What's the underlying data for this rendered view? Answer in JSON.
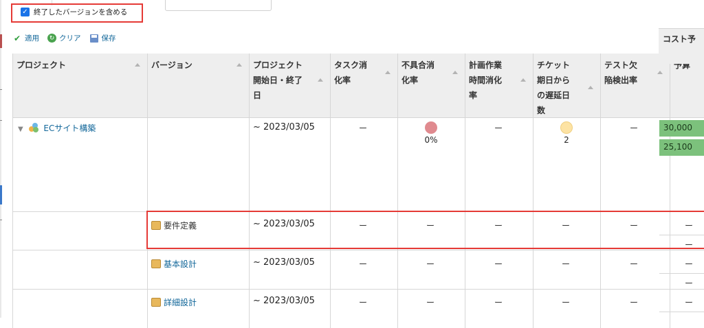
{
  "filter": {
    "include_closed_label": "終了したバージョンを含める",
    "include_closed_checked": true
  },
  "toolbar": {
    "apply": "適用",
    "clear": "クリア",
    "save": "保存"
  },
  "table": {
    "headers": {
      "project": "プロジェクト",
      "version": "バージョン",
      "dates": [
        "プロジェクト",
        "開始日・終了",
        "日"
      ],
      "task": [
        "タスク消",
        "化率"
      ],
      "defect": [
        "不具合消",
        "化率"
      ],
      "plan": [
        "計画作業",
        "時間消化",
        "率"
      ],
      "ticket": [
        "チケット",
        "期日から",
        "の遅延日",
        "数"
      ],
      "testdef": [
        "テスト欠",
        "陥検出率"
      ],
      "budget": "予算",
      "budget_sub": "コスト予"
    },
    "dash": "ー",
    "project_row": {
      "name": "ECサイト構築",
      "date": "~ 2023/03/05",
      "defect_value": "0%",
      "ticket_value": "2",
      "budget_top": "30,000",
      "budget_bottom": "25,100",
      "defect_color": "#e08a8f",
      "ticket_color": "#fde3a4"
    },
    "versions": [
      {
        "name": "要件定義",
        "date": "~ 2023/03/05",
        "link": false
      },
      {
        "name": "基本設計",
        "date": "~ 2023/03/05",
        "link": true
      },
      {
        "name": "詳細設計",
        "date": "~ 2023/03/05",
        "link": true
      }
    ]
  }
}
